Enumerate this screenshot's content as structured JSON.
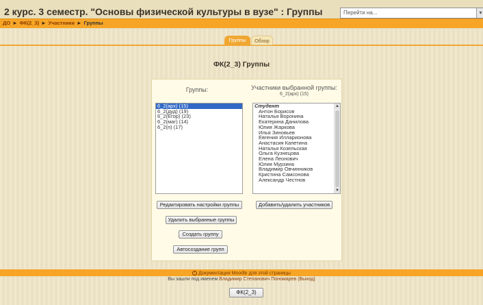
{
  "header": {
    "title": "2 курс. 3 семестр. \"Основы физической культуры в вузе\" : Группы",
    "jump_placeholder": "Перейти на..."
  },
  "breadcrumb": {
    "items": [
      "ДО",
      "ФК(2_3)",
      "Участники",
      "Группы"
    ],
    "separator": "►"
  },
  "tabs": [
    {
      "label": "Группы",
      "active": true
    },
    {
      "label": "Обзор",
      "active": false
    }
  ],
  "main": {
    "title": "ФК(2_3) Группы",
    "groups_heading": "Группы:",
    "groups": [
      {
        "label": "6_2(арх) (15)",
        "selected": true
      },
      {
        "label": "6_2(дуд) (19)",
        "selected": false
      },
      {
        "label": "6_2(Егор) (23)",
        "selected": false
      },
      {
        "label": "6_2(маг) (14)",
        "selected": false
      },
      {
        "label": "6_2(п) (17)",
        "selected": false
      }
    ],
    "members_heading": "Участники выбранной группы:",
    "members_subheading": "6_2(арх) (15)",
    "members_role": "Студент",
    "members": [
      "Антон Борисов",
      "Наталья Воронина",
      "Екатерина Данилова",
      "Юлия Жаркова",
      "Илья Зиновьев",
      "Евгения Илларионова",
      "Анастасия Капетина",
      "Наталья Козельская",
      "Ольга Кузнецова",
      "Елена Леонович",
      "Юлия Мурзина",
      "Владимир Овчинников",
      "Кристина Самсонова",
      "Александр Честнов"
    ],
    "buttons": {
      "edit": "Редактировать настройки группы",
      "add_remove": "Добавить/удалить участников",
      "delete": "Удалить выбранные группы",
      "create": "Создать группу",
      "auto": "Автосоздание групп"
    }
  },
  "footer": {
    "doc_link": "Документация Moodle для этой страницы",
    "login_prefix": "Вы зашли под именем",
    "user_name": "Владимир Степанович Пономарев",
    "logout": "(Выход)",
    "course_button": "ФК(2_3)"
  }
}
